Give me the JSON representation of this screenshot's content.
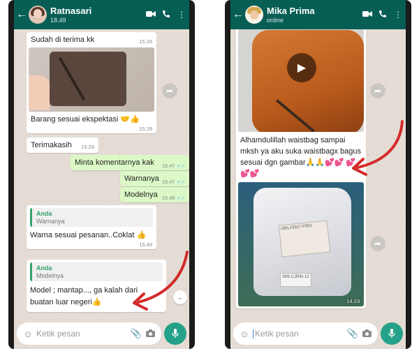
{
  "left_chat": {
    "contact_name": "Ratnasari",
    "contact_status": "18.49",
    "icons": {
      "back": "arrow-left-icon",
      "video": "video-call-icon",
      "call": "phone-icon",
      "menu": "more-vertical-icon"
    },
    "messages": {
      "m1": {
        "text": "Sudah di terima kk",
        "time": "15.28"
      },
      "m2": {
        "caption": "Barang sesuai ekspektasi 🤝👍",
        "time": "15.28"
      },
      "m3": {
        "text": "Terimakasih",
        "time": "15.29"
      },
      "m4": {
        "text": "Minta komentarnya kak",
        "time": "15.47"
      },
      "m5": {
        "text": "Warnanya",
        "time": "15.47"
      },
      "m6": {
        "text": "Modelnya",
        "time": "15.48"
      },
      "m7": {
        "quote_author": "Anda",
        "quote_text": "Warnanya",
        "text": "Warna sesuai pesanan..Coklat 👍",
        "time": "15.49"
      },
      "m8": {
        "quote_author": "Anda",
        "quote_text": "Modelnya",
        "text": "Model ; mantap..., ga kalah dari buatan luar negeri👍"
      }
    },
    "composer_placeholder": "Ketik pesan"
  },
  "right_chat": {
    "contact_name": "Mika Prima",
    "contact_status": "online",
    "messages": {
      "r1": {
        "caption": "Alhamdulillah waistbag sampai mksh ya aku suka waistbagx bagus sesuai dgn gambar🙏🙏💕💕 💕💕💕"
      },
      "r2": {
        "time": "14.23",
        "label_text": "ORLY3327 P301",
        "label2_text": "SMI-CJRIN 12"
      }
    },
    "composer_placeholder": "Ketik pesan"
  },
  "colors": {
    "header": "#075e54",
    "outgoing": "#dcf8c6",
    "accent": "#25a18a",
    "annotation": "#d42b2b"
  }
}
